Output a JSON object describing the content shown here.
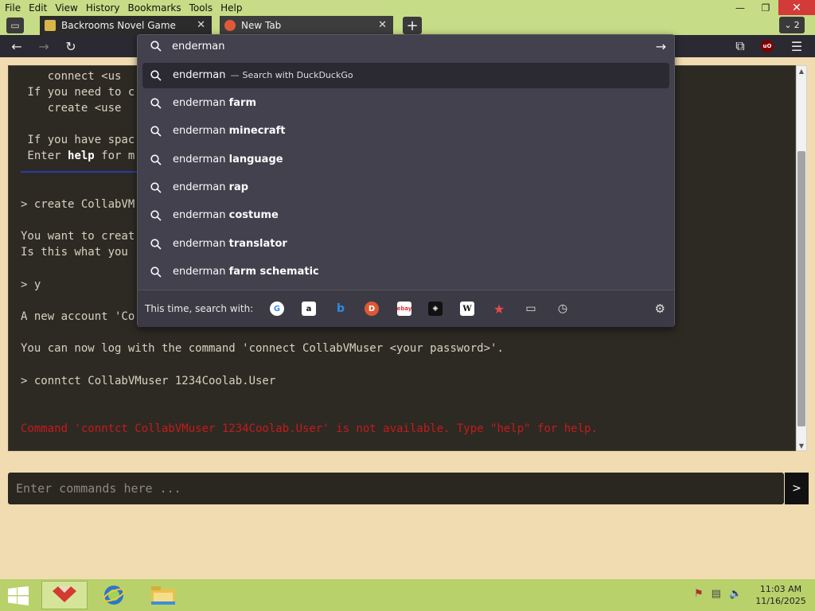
{
  "menubar": {
    "items": [
      "File",
      "Edit",
      "View",
      "History",
      "Bookmarks",
      "Tools",
      "Help"
    ]
  },
  "window_controls": {
    "minimize": "—",
    "restore": "❐",
    "close": "✕"
  },
  "tabs": [
    {
      "title": "Backrooms Novel Game",
      "close": "✕"
    },
    {
      "title": "New Tab",
      "close": "✕"
    }
  ],
  "tab_count": "2",
  "urlbar": {
    "query": "enderman",
    "suggestions": [
      {
        "prefix": "enderman",
        "suffix": "",
        "dash": "—",
        "engine_label": "Search with DuckDuckGo",
        "selected": true
      },
      {
        "prefix": "enderman",
        "suffix": "farm"
      },
      {
        "prefix": "enderman",
        "suffix": "minecraft"
      },
      {
        "prefix": "enderman",
        "suffix": "language"
      },
      {
        "prefix": "enderman",
        "suffix": "rap"
      },
      {
        "prefix": "enderman",
        "suffix": "costume"
      },
      {
        "prefix": "enderman",
        "suffix": "translator"
      },
      {
        "prefix": "enderman",
        "suffix": "farm schematic"
      }
    ],
    "oneoff_label": "This time, search with:",
    "engines": [
      "google-icon",
      "amazon-icon",
      "bing-icon",
      "duckduckgo-icon",
      "ebay-icon",
      "bookmarks-like-icon",
      "wikipedia-icon",
      "bookmarks-icon",
      "tabs-icon",
      "history-icon"
    ]
  },
  "terminal": {
    "lines": [
      {
        "text": "    connect <us",
        "row": 0
      },
      {
        "text": " If you need to c",
        "row": 1
      },
      {
        "text": "    create <use",
        "row": 2
      },
      {
        "text": " If you have spac",
        "row": 4
      },
      {
        "text_before": " Enter ",
        "bold": "help",
        "text_after": " for m",
        "row": 5
      },
      {
        "text": "> create CollabVM",
        "row": 8
      },
      {
        "text": "You want to creat",
        "row": 10
      },
      {
        "text": "Is this what you ",
        "row": 11
      },
      {
        "text": "> y",
        "row": 13
      },
      {
        "text": "A new account 'Co",
        "row": 15
      },
      {
        "text": "You can now log with the command 'connect CollabVMuser <your password>'.",
        "row": 17
      },
      {
        "text": "> conntct CollabVMuser 1234Coolab.User",
        "row": 19
      }
    ],
    "error": "Command 'conntct CollabVMuser 1234Coolab.User' is not available. Type \"help\" for help."
  },
  "command_input": {
    "placeholder": "Enter commands here ...",
    "send_label": ">"
  },
  "taskbar": {
    "clock_time": "11:03 AM",
    "clock_date": "11/16/2025"
  }
}
